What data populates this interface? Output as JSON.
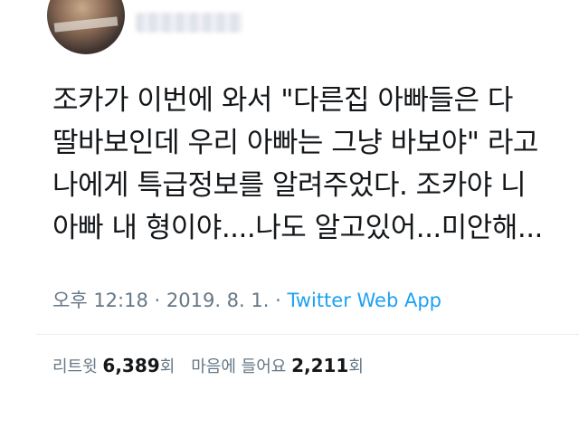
{
  "tweet": {
    "lines": [
      "조카가 이번에 와서 \"다른집 아빠들은 다",
      "딸바보인데 우리 아빠는 그냥 바보야\" 라고",
      "나에게 특급정보를 알려주었다. 조카야 니",
      "아빠 내 형이야....나도 알고있어...미안해..."
    ],
    "time": "오후 12:18",
    "separator1": " · ",
    "date": "2019. 8. 1.",
    "separator2": " · ",
    "source_app": "Twitter Web App"
  },
  "stats": {
    "retweet_label": "리트윗",
    "retweet_count": "6,389",
    "retweet_suffix": "회",
    "like_label": "마음에 들어요",
    "like_count": "2,211",
    "like_suffix": "회"
  },
  "colors": {
    "text": "#14171a",
    "muted": "#657786",
    "link": "#1da1f2",
    "divider": "#e6ecf0"
  }
}
